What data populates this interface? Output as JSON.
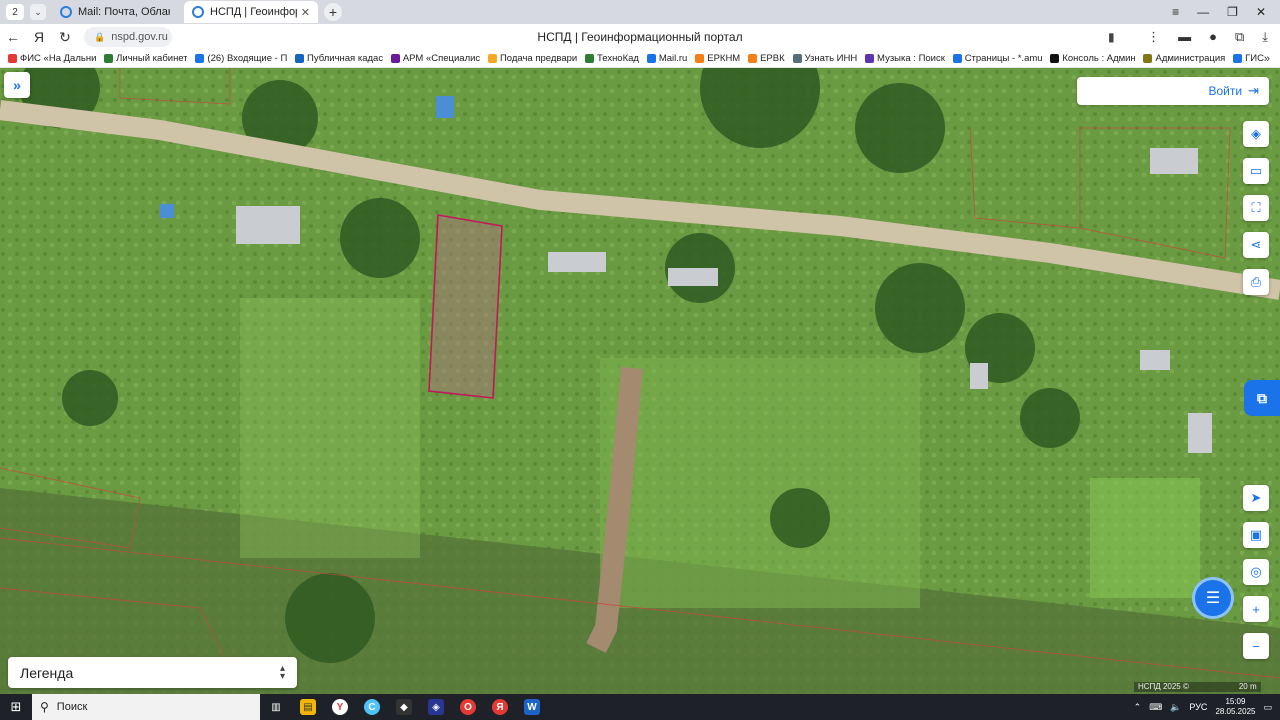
{
  "browser": {
    "tab_count": "2",
    "tabs": [
      {
        "title": "Mail: Почта, Облако, Кале"
      },
      {
        "title": "НСПД | Геоинформаци"
      }
    ],
    "url": "nspd.gov.ru",
    "page_title": "НСПД | Геоинформационный портал"
  },
  "bookmarks": [
    {
      "label": "ФИС «На Дальни",
      "color": "#e53935"
    },
    {
      "label": "Личный кабинет",
      "color": "#2e7d32"
    },
    {
      "label": "(26) Входящие - П",
      "color": "#1a73e8"
    },
    {
      "label": "Публичная кадас",
      "color": "#1565c0"
    },
    {
      "label": "АРМ «Специалис",
      "color": "#6a1b9a"
    },
    {
      "label": "Подача предвари",
      "color": "#f9a825"
    },
    {
      "label": "ТехноКад",
      "color": "#2e7d32"
    },
    {
      "label": "Mail.ru",
      "color": "#1a73e8"
    },
    {
      "label": "ЕРКНМ",
      "color": "#f57f17"
    },
    {
      "label": "ЕРВК",
      "color": "#f57f17"
    },
    {
      "label": "Узнать ИНН",
      "color": "#546e7a"
    },
    {
      "label": "Музыка : Поиск",
      "color": "#5e35b1"
    },
    {
      "label": "Страницы - *.amu",
      "color": "#1a73e8"
    },
    {
      "label": "Консоль : Админ",
      "color": "#111111"
    },
    {
      "label": "Администрация",
      "color": "#827717"
    },
    {
      "label": "ГИС",
      "color": "#1a73e8"
    }
  ],
  "map": {
    "login_label": "Войти",
    "legend_label": "Легенда",
    "attribution": "НСПД 2025 ©",
    "scale_label": "20 m"
  },
  "taskbar": {
    "search_placeholder": "Поиск",
    "language": "РУС",
    "time": "15:09",
    "date": "28.05.2025"
  },
  "colors": {
    "accent": "#1a73e8",
    "parcel_outline": "#c2185b"
  }
}
